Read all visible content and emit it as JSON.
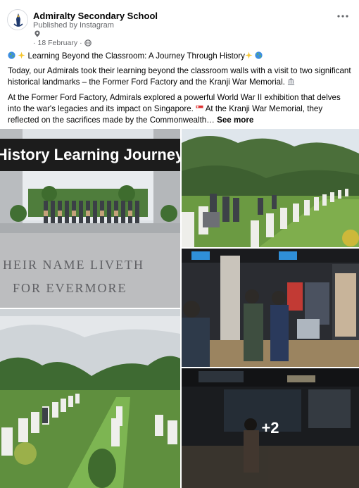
{
  "post": {
    "page_name": "Admiralty Secondary School",
    "published_by": "Published by Instagram",
    "date": "18 February",
    "separator": "·",
    "more_icon": "more-dots-icon",
    "headline": "Learning Beyond the Classroom: A Journey Through History",
    "paragraph_1": "Today, our Admirals took their learning beyond the classroom walls with a visit to two significant historical landmarks – the Former Ford Factory and the Kranji War Memorial.",
    "paragraph_2_a": "At the Former Ford Factory, Admirals explored a powerful World War II exhibition that delves into the war's legacies and its impact on Singapore.",
    "paragraph_2_b": "At the Kranji War Memorial, they reflected on the sacrifices made by the Commonwealth…",
    "see_more": "See more"
  },
  "photos": {
    "photo_1_banner": "History Learning Journey",
    "photo_1_inscription_line_1": "HEIR NAME LIVETH",
    "photo_1_inscription_line_2": "FOR EVERMORE",
    "photo_6_overlay": "+2"
  },
  "colors": {
    "text_primary": "#050505",
    "text_secondary": "#65676b",
    "banner_bg": "#1c1c1c"
  }
}
